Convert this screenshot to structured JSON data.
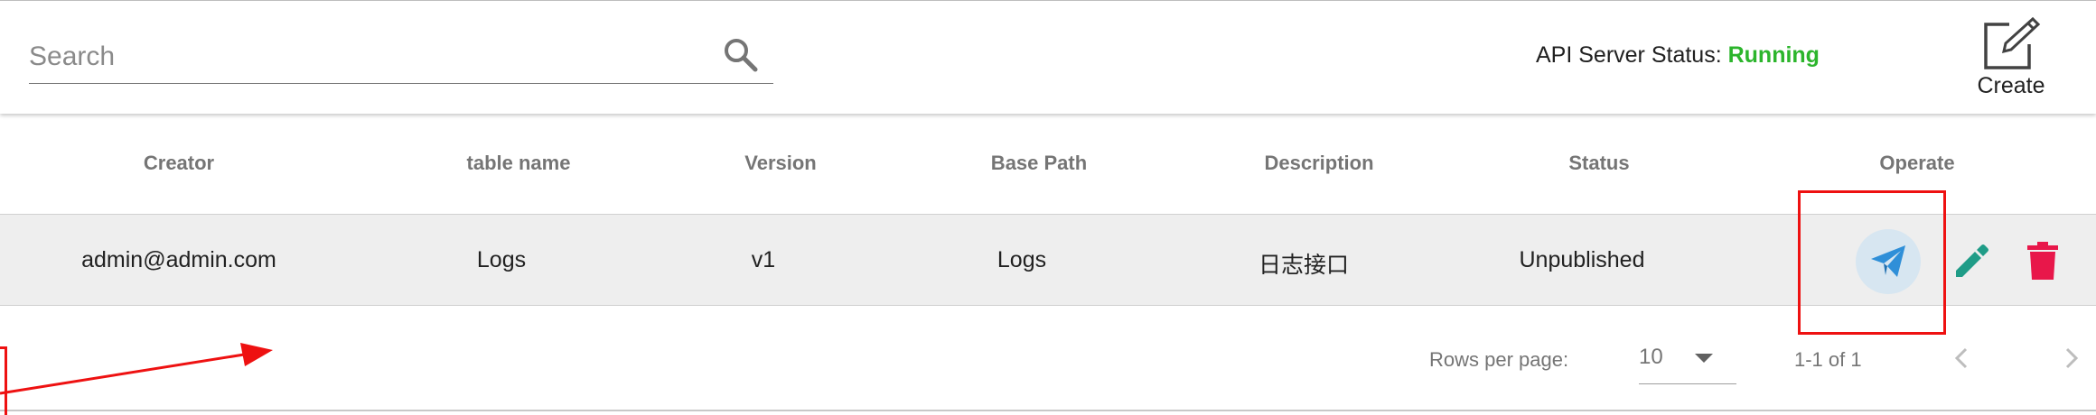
{
  "search": {
    "placeholder": "Search",
    "value": ""
  },
  "header": {
    "api_status_label": "API Server Status:",
    "api_status_value": "Running",
    "create_label": "Create"
  },
  "table": {
    "columns": [
      "Creator",
      "table name",
      "Version",
      "Base Path",
      "Description",
      "Status",
      "Operate"
    ],
    "rows": [
      {
        "creator": "admin@admin.com",
        "table_name": "Logs",
        "version": "v1",
        "base_path": "Logs",
        "description": "日志接口",
        "status": "Unpublished"
      }
    ]
  },
  "pagination": {
    "rows_per_page_label": "Rows per page:",
    "rows_per_page_value": "10",
    "range": "1-1 of 1"
  },
  "icons": {
    "search": "search-icon",
    "create": "edit-square-icon",
    "publish": "send-icon",
    "edit": "pencil-icon",
    "delete": "trash-icon",
    "prev": "chevron-left-icon",
    "next": "chevron-right-icon",
    "dropdown": "caret-down-icon"
  },
  "colors": {
    "running": "#2cb52c",
    "publish": "#2f8fd8",
    "edit": "#1f9c87",
    "delete": "#e8174a",
    "annotation": "#ee1111"
  }
}
